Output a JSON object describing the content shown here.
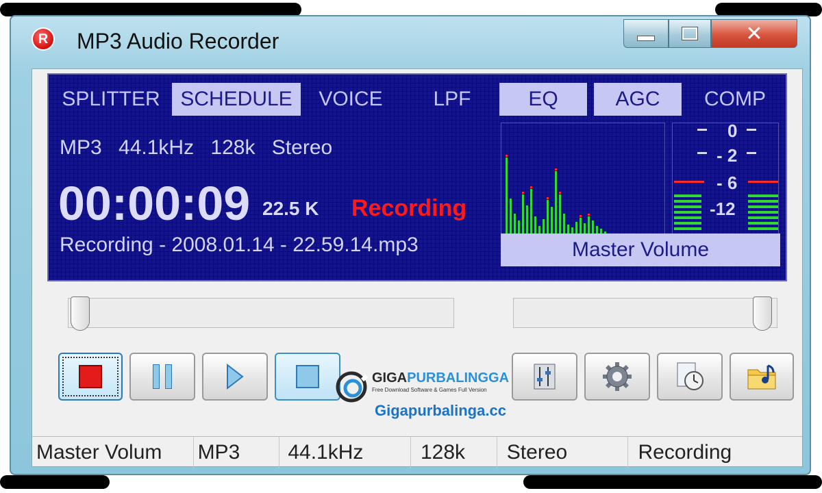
{
  "window": {
    "title": "MP3 Audio Recorder",
    "icon_letter": "R"
  },
  "tabs": [
    {
      "label": "SPLITTER",
      "active": false
    },
    {
      "label": "SCHEDULE",
      "active": true
    },
    {
      "label": "VOICE",
      "active": false
    },
    {
      "label": "LPF",
      "active": false
    },
    {
      "label": "EQ",
      "active": true
    },
    {
      "label": "AGC",
      "active": true
    },
    {
      "label": "COMP",
      "active": false
    }
  ],
  "display": {
    "format_info": "MP3 44.1kHz 128k Stereo",
    "timer": "00:00:09",
    "size": "22.5 K",
    "status": "Recording",
    "filename": "Recording - 2008.01.14 - 22.59.14.mp3",
    "vu_labels": [
      "0",
      "- 2",
      "- 6",
      "-12"
    ],
    "master_volume": "Master Volume"
  },
  "sliders": {
    "position": 0.0,
    "volume": 1.0
  },
  "buttons": {
    "record": "record-icon",
    "pause": "pause-icon",
    "play": "play-icon",
    "stop": "stop-icon",
    "mixer": "mixer-icon",
    "settings": "gear-icon",
    "schedule": "timer-icon",
    "open_folder": "music-folder-icon"
  },
  "watermark": {
    "brand_part1": "GIGA",
    "brand_part2": "PURBALINGGA",
    "tagline": "Free Download Software & Games Full Version",
    "url": "Gigapurbalinga.cc"
  },
  "statusbar": [
    "Master Volum",
    "MP3",
    "44.1kHz",
    "128k",
    "Stereo",
    "Recording"
  ],
  "colors": {
    "display_bg": "#14148c",
    "highlight": "#c7c7f3",
    "recording_red": "#ff1a1a",
    "spectrum_green": "#33d633",
    "peak_red": "#ff2a2a"
  }
}
